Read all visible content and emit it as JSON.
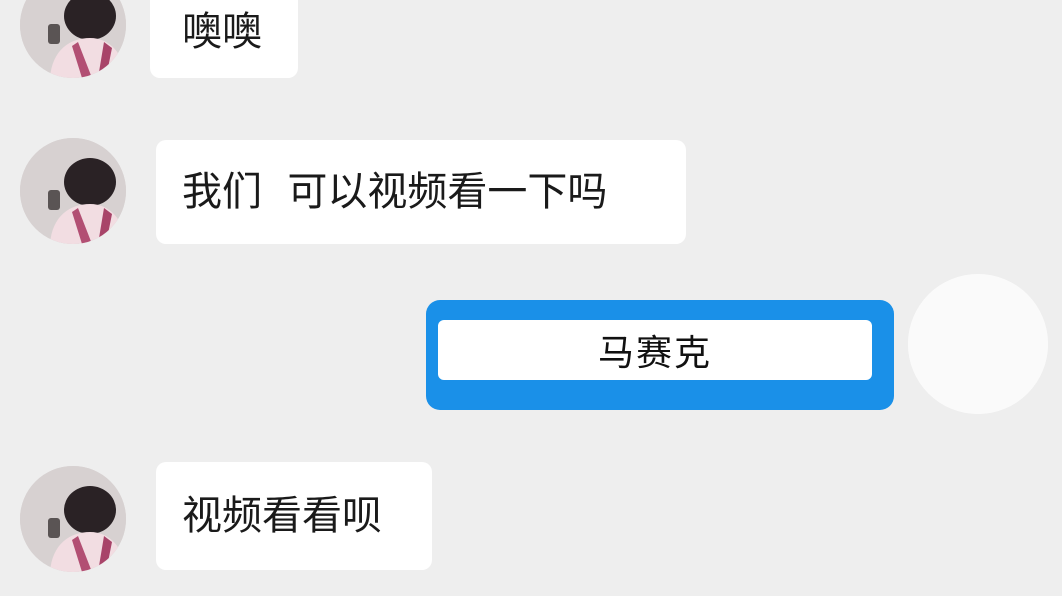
{
  "conversation": {
    "messages": [
      {
        "side": "left",
        "text": "噢噢"
      },
      {
        "side": "left",
        "text": "我们  可以视频看一下吗"
      },
      {
        "side": "right",
        "text": "马赛克"
      },
      {
        "side": "left",
        "text": "视频看看呗"
      }
    ]
  },
  "colors": {
    "background": "#eeeeee",
    "bubble": "#ffffff",
    "mask_frame": "#1a90e8"
  },
  "icons": {
    "sender_avatar": "user-avatar-icon",
    "self_avatar": "user-avatar-icon"
  }
}
